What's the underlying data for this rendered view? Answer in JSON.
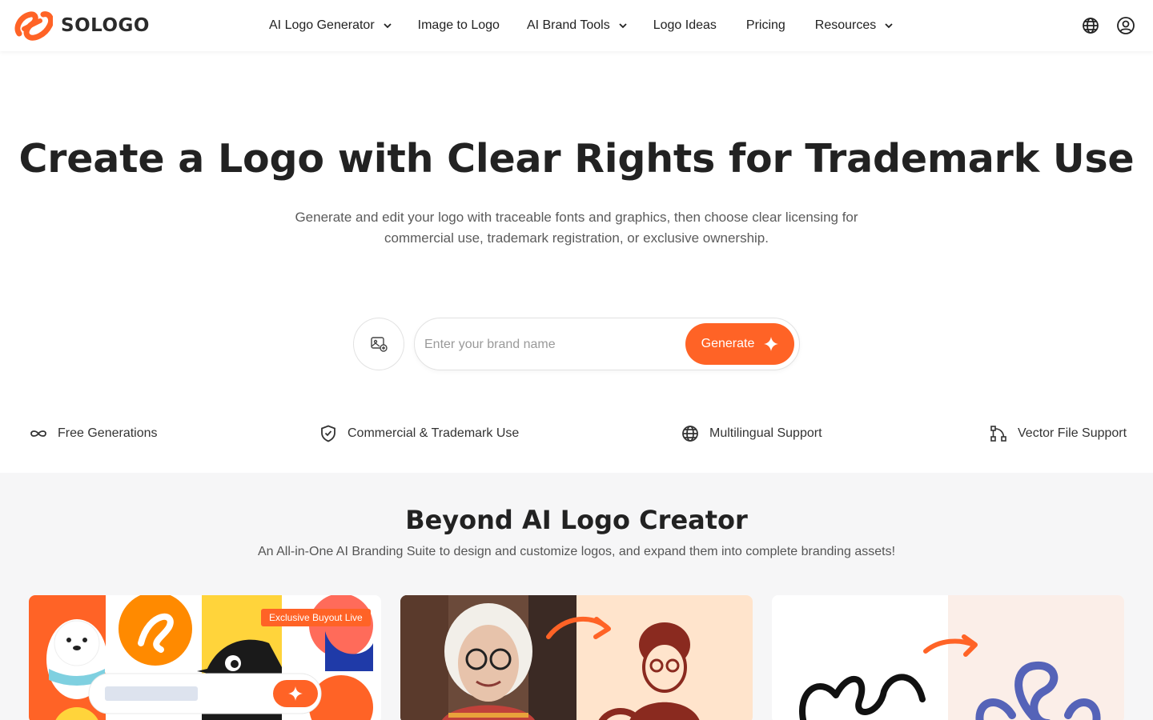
{
  "header": {
    "brand": "SOLOGO",
    "nav": [
      {
        "label": "AI Logo Generator",
        "dropdown": true
      },
      {
        "label": "Image to Logo",
        "dropdown": false
      },
      {
        "label": "AI Brand Tools",
        "dropdown": true
      },
      {
        "label": "Logo Ideas",
        "dropdown": false
      },
      {
        "label": "Pricing",
        "dropdown": false
      },
      {
        "label": "Resources",
        "dropdown": true
      }
    ],
    "icons": [
      "globe-icon",
      "user-account-icon"
    ]
  },
  "hero": {
    "title": "Create a Logo with Clear Rights for Trademark Use",
    "subtitle": "Generate and edit your logo with traceable fonts and graphics, then choose clear licensing for commercial use, trademark registration, or exclusive ownership.",
    "search": {
      "placeholder": "Enter your brand name",
      "value": ""
    },
    "generate_label": "Generate"
  },
  "features": [
    {
      "label": "Free Generations",
      "icon": "infinity-icon"
    },
    {
      "label": "Commercial & Trademark Use",
      "icon": "shield-check-icon"
    },
    {
      "label": "Multilingual Support",
      "icon": "globe-icon"
    },
    {
      "label": "Vector File Support",
      "icon": "vector-nodes-icon"
    }
  ],
  "section": {
    "title": "Beyond AI Logo Creator",
    "subtitle": "An All-in-One AI Branding Suite to design and customize logos, and expand them into complete branding assets!",
    "cards": [
      {
        "badge": "Exclusive Buyout Live"
      },
      {
        "badge": ""
      },
      {
        "badge": ""
      }
    ]
  },
  "colors": {
    "accent": "#ff6326",
    "text": "#222222",
    "muted": "#5b5b5b",
    "section_bg": "#f6f6f7"
  }
}
